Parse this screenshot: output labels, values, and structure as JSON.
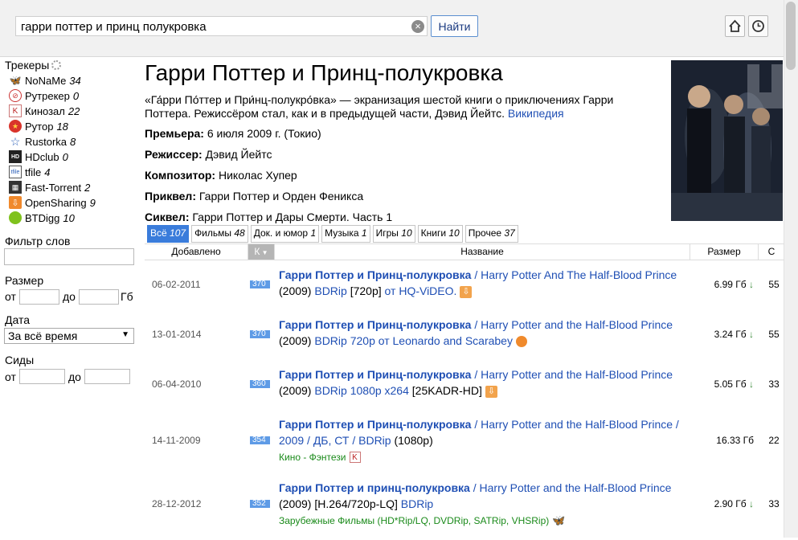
{
  "search": {
    "query": "гарри поттер и принц полукровка",
    "button_label": "Найти"
  },
  "sidebar": {
    "trackers_title": "Трекеры",
    "trackers": [
      {
        "name": "NoNaMe",
        "count": "34",
        "icon": "butterfly-icon"
      },
      {
        "name": "Рутрекер",
        "count": "0",
        "icon": "rutracker-icon"
      },
      {
        "name": "Кинозал",
        "count": "22",
        "icon": "kinozal-icon"
      },
      {
        "name": "Рутор",
        "count": "18",
        "icon": "rutor-icon"
      },
      {
        "name": "Rustorka",
        "count": "8",
        "icon": "star-icon"
      },
      {
        "name": "HDclub",
        "count": "0",
        "icon": "hdclub-icon"
      },
      {
        "name": "tfile",
        "count": "4",
        "icon": "tfile-icon"
      },
      {
        "name": "Fast-Torrent",
        "count": "2",
        "icon": "film-icon"
      },
      {
        "name": "OpenSharing",
        "count": "9",
        "icon": "opensharing-icon"
      },
      {
        "name": "BTDigg",
        "count": "10",
        "icon": "btdigg-icon"
      }
    ],
    "word_filter_label": "Фильтр слов",
    "size_label": "Размер",
    "from_label": "от",
    "to_label": "до",
    "size_unit": "Гб",
    "date_label": "Дата",
    "date_selected": "За всё время",
    "seeds_label": "Сиды"
  },
  "movie": {
    "title": "Гарри Поттер и Принц-полукровка",
    "description": "«Га́рри По́ттер и При́нц-полукро́вка» — экранизация шестой книги о приключениях Гарри Поттера. Режиссёром стал, как и в предыдущей части, Дэвид Йейтс.",
    "wiki_link": "Википедия",
    "premiere_label": "Премьера:",
    "premiere_value": "6 июля 2009 г. (Токио)",
    "director_label": "Режиссер:",
    "director_value": "Дэвид Йейтс",
    "composer_label": "Композитор:",
    "composer_value": "Николас Хупер",
    "prequel_label": "Приквел:",
    "prequel_value": "Гарри Поттер и Орден Феникса",
    "sequel_label": "Сиквел:",
    "sequel_value": "Гарри Поттер и Дары Смерти. Часть 1"
  },
  "tabs": [
    {
      "label": "Всё",
      "count": "107",
      "active": true
    },
    {
      "label": "Фильмы",
      "count": "48"
    },
    {
      "label": "Док. и юмор",
      "count": "1"
    },
    {
      "label": "Музыка",
      "count": "1"
    },
    {
      "label": "Игры",
      "count": "10"
    },
    {
      "label": "Книги",
      "count": "10"
    },
    {
      "label": "Прочее",
      "count": "37"
    }
  ],
  "table": {
    "columns": {
      "added": "Добавлено",
      "k": "К",
      "name": "Название",
      "size": "Размер",
      "seeds": "С"
    },
    "rows": [
      {
        "date": "06-02-2011",
        "k": "370",
        "title_bold": "Гарри Поттер и Принц-полукровка",
        "title_rest": "/ Harry Potter And The Half-Blood Prince",
        "line2_plain": "(2009)",
        "line2_link": "BDRip",
        "line2_plain2": "[720p]",
        "line2_link2": "от HQ-ViDEO.",
        "line3": "",
        "size": "6.99 Гб",
        "seeds": "55"
      },
      {
        "date": "13-01-2014",
        "k": "370",
        "title_bold": "Гарри Поттер и Принц-полукровка",
        "title_rest": "/ Harry Potter and the Half-Blood Prince",
        "line2_plain": "(2009)",
        "line2_link": "BDRip 720p от Leonardo and Scarabey",
        "line2_plain2": "",
        "line2_link2": "",
        "line3": "",
        "size": "3.24 Гб",
        "seeds": "55"
      },
      {
        "date": "06-04-2010",
        "k": "360",
        "title_bold": "Гарри Поттер и Принц-полукровка",
        "title_rest": "/ Harry Potter and the Half-Blood Prince",
        "line2_plain": "(2009)",
        "line2_link": "BDRip 1080p x264",
        "line2_plain2": "[25KADR-HD]",
        "line2_link2": "",
        "line3": "",
        "size": "5.05 Гб",
        "seeds": "33"
      },
      {
        "date": "14-11-2009",
        "k": "354",
        "title_bold": "Гарри Поттер и Принц-полукровка",
        "title_rest": "/ Harry Potter and the Half-Blood Prince /",
        "line2_plain": "",
        "line2_link": "2009 / ДБ, СТ / BDRip",
        "line2_plain2": "(1080p)",
        "line2_link2": "",
        "line3": "Кино - Фэнтези",
        "size": "16.33 Гб",
        "seeds": "22"
      },
      {
        "date": "28-12-2012",
        "k": "352",
        "title_bold": "Гарри Поттер и принц-полукровка",
        "title_rest": "/ Harry Potter and the Half-Blood Prince",
        "line2_plain": "(2009) [H.264/720p-LQ]",
        "line2_link": "BDRip",
        "line2_plain2": "",
        "line2_link2": "",
        "line3": "Зарубежные Фильмы (HD*Rip/LQ, DVDRip, SATRip, VHSRip)",
        "size": "2.90 Гб",
        "seeds": "33"
      }
    ]
  },
  "colors": {
    "accent": "#3a7cdb",
    "link": "#1f4fb4",
    "category": "#1a8a1a"
  }
}
